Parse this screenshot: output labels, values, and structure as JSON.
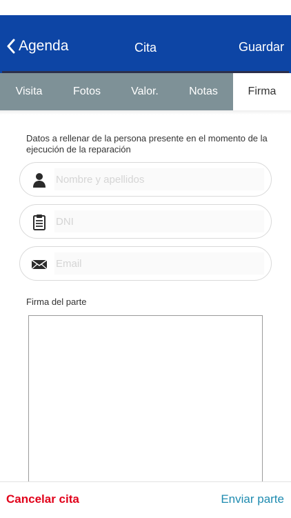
{
  "nav": {
    "back_label": "Agenda",
    "title": "Cita",
    "save_label": "Guardar"
  },
  "tabs": [
    {
      "label": "Visita",
      "active": false
    },
    {
      "label": "Fotos",
      "active": false
    },
    {
      "label": "Valor.",
      "active": false
    },
    {
      "label": "Notas",
      "active": false
    },
    {
      "label": "Firma",
      "active": true
    }
  ],
  "form": {
    "intro": "Datos a rellenar de la persona presente en el momento de la ejecución de la reparación",
    "name_placeholder": "Nombre y apellidos",
    "dni_placeholder": "DNI",
    "email_placeholder": "Email",
    "signature_label": "Firma del parte"
  },
  "footer": {
    "cancel_label": "Cancelar cita",
    "send_label": "Enviar parte"
  },
  "colors": {
    "navbar": "#0d45a5",
    "tab_inactive": "#7e9197",
    "cancel": "#e1001a",
    "send": "#1e8bb0"
  },
  "icons": [
    "chevron-left-icon",
    "person-icon",
    "clipboard-icon",
    "envelope-icon"
  ]
}
